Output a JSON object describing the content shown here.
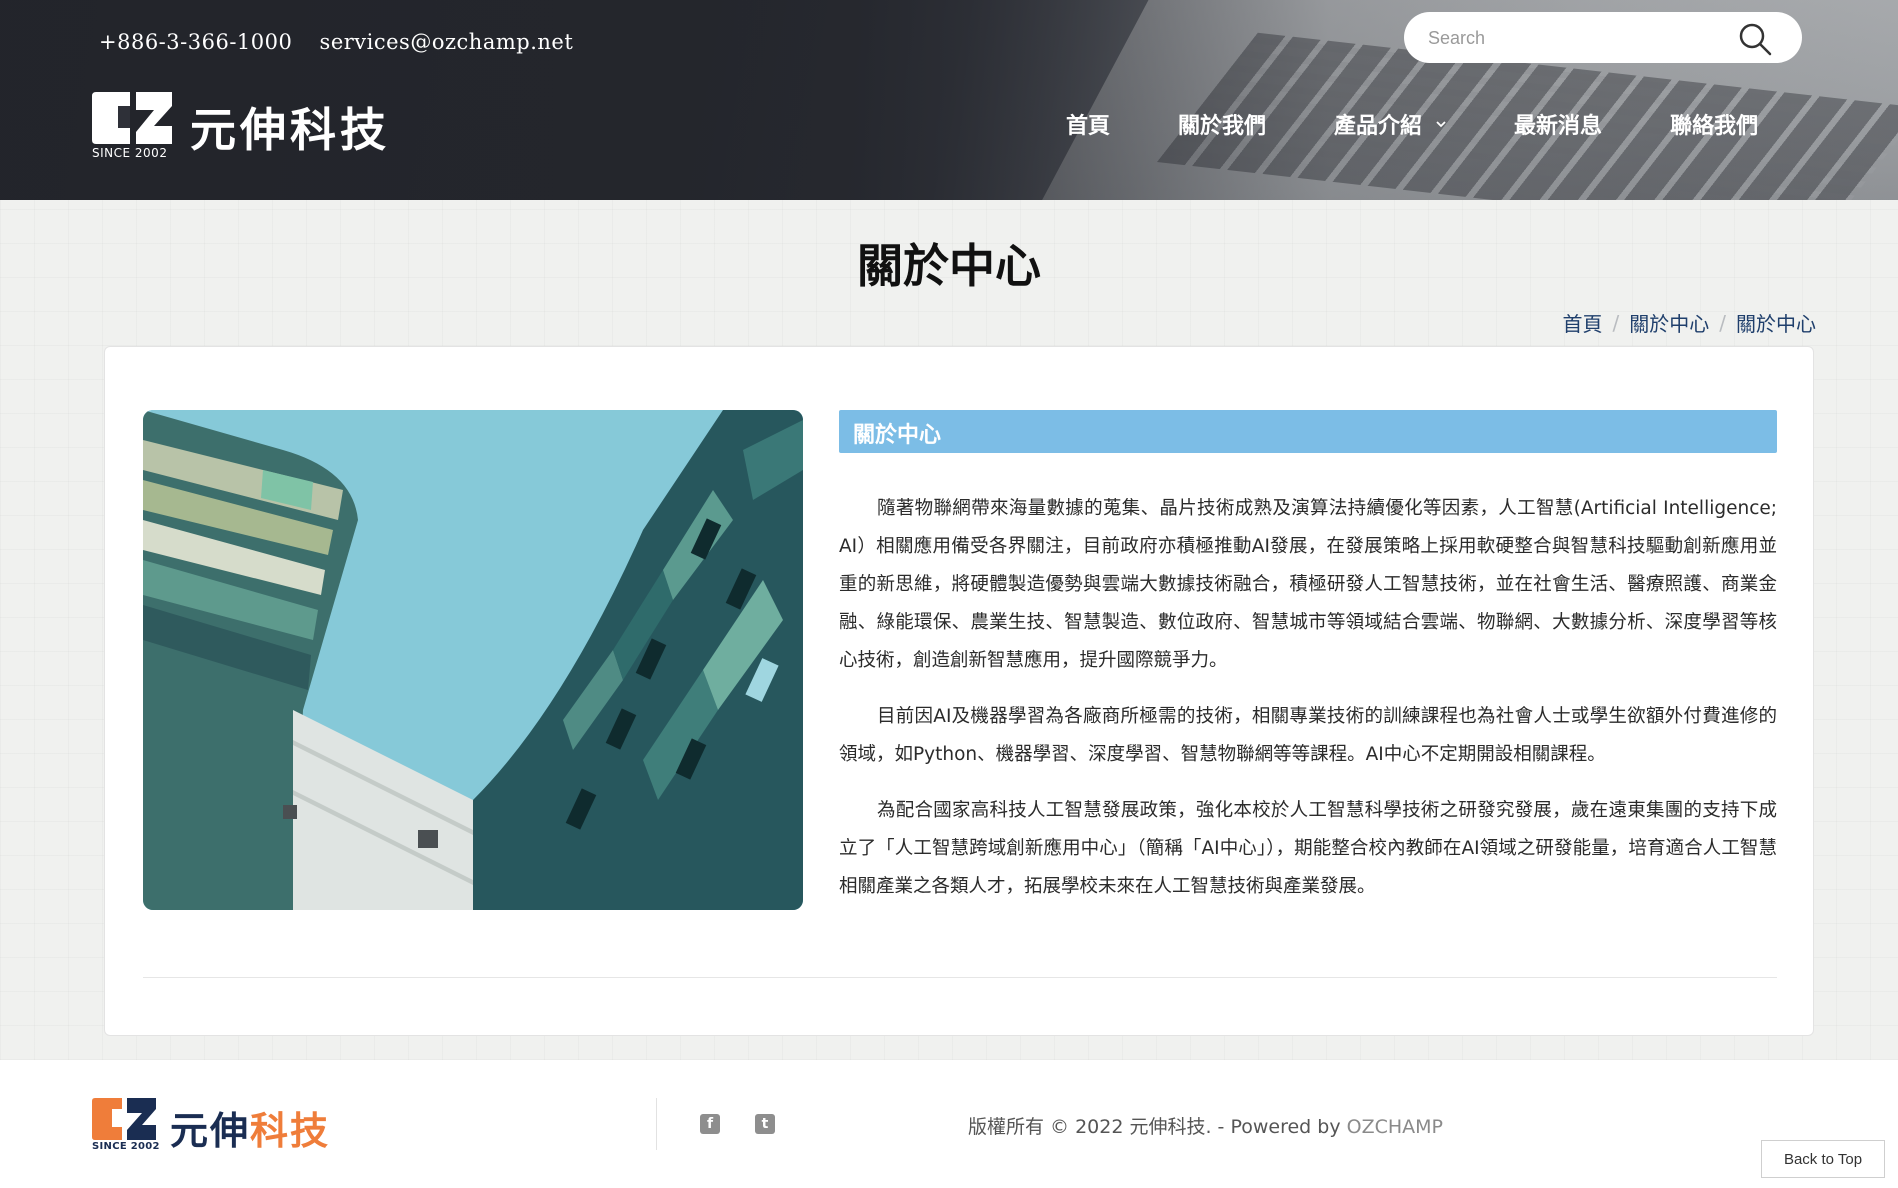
{
  "header": {
    "phone": "+886-3-366-1000",
    "email": "services@ozchamp.net",
    "logo_text": "元伸科技",
    "logo_since": "SINCE 2002",
    "search_placeholder": "Search",
    "nav": [
      {
        "label": "首頁"
      },
      {
        "label": "關於我們"
      },
      {
        "label": "產品介紹"
      },
      {
        "label": "最新消息"
      },
      {
        "label": "聯絡我們"
      }
    ]
  },
  "main": {
    "page_title": "關於中心",
    "breadcrumb": [
      "首頁",
      "關於中心",
      "關於中心"
    ],
    "section_title": "關於中心",
    "paragraphs": [
      "隨著物聯網帶來海量數據的蒐集、晶片技術成熟及演算法持續優化等因素，人工智慧(Artificial Intelligence; AI）相關應用備受各界關注，目前政府亦積極推動AI發展，在發展策略上採用軟硬整合與智慧科技驅動創新應用並重的新思維，將硬體製造優勢與雲端大數據技術融合，積極研發人工智慧技術，並在社會生活、醫療照護、商業金融、綠能環保、農業生技、智慧製造、數位政府、智慧城市等領域結合雲端、物聯網、大數據分析、深度學習等核心技術，創造創新智慧應用，提升國際競爭力。",
      "目前因AI及機器學習為各廠商所極需的技術，相關專業技術的訓練課程也為社會人士或學生欲額外付費進修的領域，如Python、機器學習、深度學習、智慧物聯網等等課程。AI中心不定期開設相關課程。",
      "為配合國家高科技人工智慧發展政策，強化本校於人工智慧科學技術之研發究發展，歲在遠東集團的支持下成立了「人工智慧跨域創新應用中心」（簡稱「AI中心」），期能整合校內教師在AI領域之研發能量，培育適合人工智慧相關產業之各類人才，拓展學校未來在人工智慧技術與產業發展。"
    ]
  },
  "footer": {
    "logo_text_a": "元伸",
    "logo_text_b": "科技",
    "logo_since": "SINCE 2002",
    "copyright": "版權所有 © 2022 元伸科技. - Powered by ",
    "powered_link": "OZCHAMP",
    "back_to_top": "Back to Top",
    "social_icons": [
      "facebook-icon",
      "twitter-icon"
    ]
  },
  "colors": {
    "section_bar": "#7cbde6",
    "breadcrumb_link": "#1f3f6c",
    "brand_orange": "#ef7d3a",
    "brand_navy": "#1a2d52"
  }
}
